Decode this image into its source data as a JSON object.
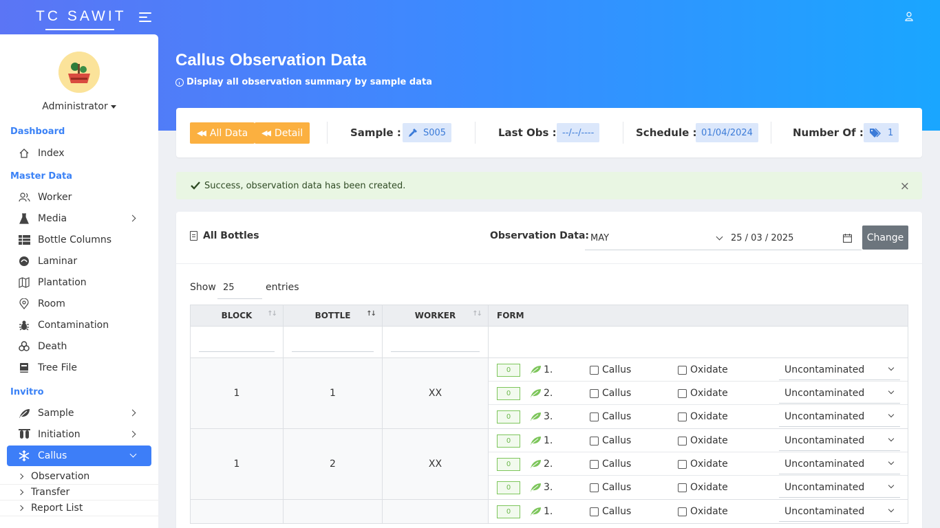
{
  "app": {
    "brand": "TC SAWIT"
  },
  "sidebar": {
    "user": "Administrator",
    "sections": {
      "dashboard": "Dashboard",
      "master": "Master Data",
      "invitro": "Invitro"
    },
    "items": {
      "index": "Index",
      "worker": "Worker",
      "media": "Media",
      "bottle_columns": "Bottle Columns",
      "laminar": "Laminar",
      "plantation": "Plantation",
      "room": "Room",
      "contamination": "Contamination",
      "death": "Death",
      "tree_file": "Tree File",
      "sample": "Sample",
      "initiation": "Initiation",
      "callus": "Callus"
    },
    "sub_items": {
      "observation": "Observation",
      "transfer": "Transfer",
      "report_list": "Report List"
    }
  },
  "header": {
    "title": "Callus Observation Data",
    "subtitle": "Display all observation summary by sample data"
  },
  "summary": {
    "all_data": "All Data",
    "detail": "Detail",
    "sample_label": "Sample :",
    "sample_value": "S005",
    "last_obs_label": "Last Obs :",
    "last_obs_value": "--/--/----",
    "schedule_label": "Schedule :",
    "schedule_value": "01/04/2024",
    "number_label": "Number Of :",
    "number_value": "1"
  },
  "alert": {
    "message": "Success, observation data has been created.",
    "close": "×"
  },
  "bottles": {
    "title": "All Bottles",
    "obs_label": "Observation Data:",
    "month": "MAY",
    "date": "25 / 03 / 2025",
    "change": "Change",
    "show": "Show",
    "entries_value": "25",
    "entries": "entries",
    "columns": {
      "block": "BLOCK",
      "bottle": "BOTTLE",
      "worker": "WORKER",
      "form": "FORM"
    },
    "form_labels": {
      "count": "0",
      "callus": "Callus",
      "oxidate": "Oxidate",
      "status": "Uncontaminated"
    },
    "rows": [
      {
        "block": "1",
        "bottle": "1",
        "worker": "XX",
        "explants": [
          "1.",
          "2.",
          "3."
        ]
      },
      {
        "block": "1",
        "bottle": "2",
        "worker": "XX",
        "explants": [
          "1.",
          "2.",
          "3."
        ]
      },
      {
        "block": "",
        "bottle": "",
        "worker": "",
        "explants": [
          "1."
        ]
      }
    ]
  },
  "colors": {
    "accent": "#3d7ef8",
    "orange": "#fbb040",
    "gradient_start": "#5b75f5",
    "gradient_end": "#1aa6ff"
  }
}
